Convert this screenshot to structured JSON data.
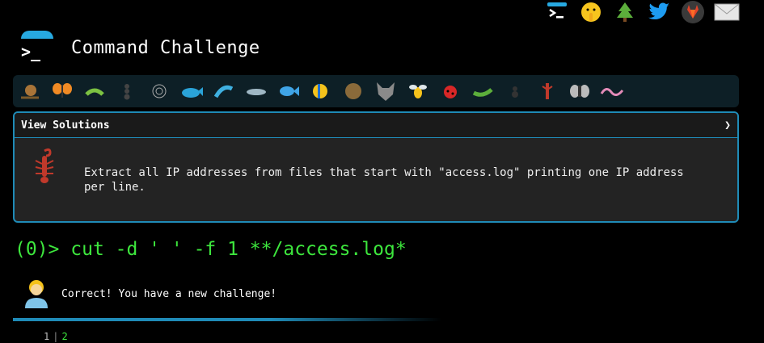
{
  "header": {
    "title": "Command Challenge",
    "prompt_glyph": ">_"
  },
  "top_icons": [
    "terminal-icon",
    "shush-emoji-icon",
    "tree-icon",
    "twitter-icon",
    "gitlab-icon",
    "mail-icon"
  ],
  "animals": [
    "snail",
    "butterfly",
    "bug",
    "ant",
    "spider-web",
    "whale",
    "dolphin-1",
    "dolphin-2",
    "fish",
    "tropical-fish",
    "blowfish",
    "wolf",
    "bee",
    "ladybug",
    "caterpillar",
    "spider",
    "scorpion",
    "fly",
    "worm"
  ],
  "panel": {
    "header": "View Solutions",
    "chevron": "❯",
    "description": "Extract all IP addresses from files that start with \"access.log\" printing one IP address per line."
  },
  "command": {
    "prompt": "(0)> ",
    "text": "cut -d ' ' -f 1 **/access.log*"
  },
  "result": {
    "message": "Correct! You have a new challenge!"
  },
  "pager": {
    "first": "1",
    "current": "2"
  },
  "colors": {
    "accent": "#1f8bb7",
    "prompt_green": "#3de63d"
  }
}
